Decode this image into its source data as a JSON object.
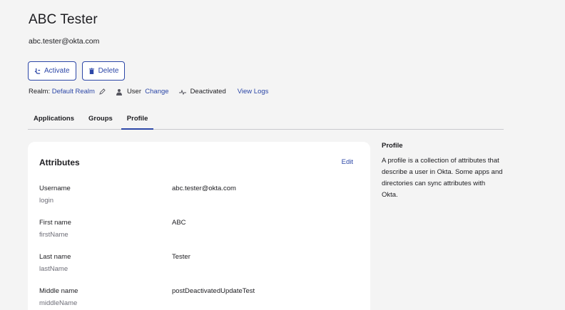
{
  "header": {
    "title": "ABC Tester",
    "email": "abc.tester@okta.com"
  },
  "actions": {
    "activate_label": "Activate",
    "delete_label": "Delete"
  },
  "meta": {
    "realm_label": "Realm:",
    "realm_value": "Default Realm",
    "user_type": "User",
    "change_label": "Change",
    "status": "Deactivated",
    "view_logs_label": "View Logs"
  },
  "tabs": [
    {
      "label": "Applications",
      "active": false
    },
    {
      "label": "Groups",
      "active": false
    },
    {
      "label": "Profile",
      "active": true
    }
  ],
  "attributes_card": {
    "title": "Attributes",
    "edit_label": "Edit",
    "rows": [
      {
        "label": "Username",
        "key": "login",
        "value": "abc.tester@okta.com"
      },
      {
        "label": "First name",
        "key": "firstName",
        "value": "ABC"
      },
      {
        "label": "Last name",
        "key": "lastName",
        "value": "Tester"
      },
      {
        "label": "Middle name",
        "key": "middleName",
        "value": "postDeactivatedUpdateTest"
      }
    ]
  },
  "sidebar": {
    "title": "Profile",
    "description": "A profile is a collection of attributes that describe a user in Okta. Some apps and directories can sync attributes with Okta."
  },
  "colors": {
    "accent": "#2c47a7",
    "background": "#f4f4f4"
  }
}
